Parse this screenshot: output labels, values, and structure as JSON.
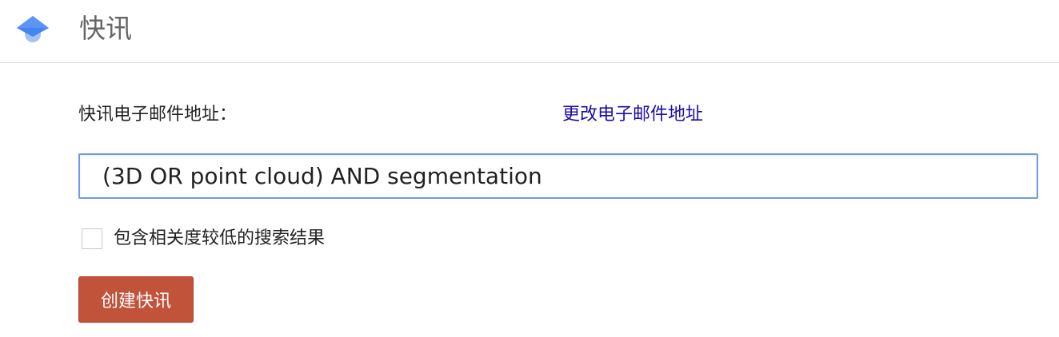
{
  "header": {
    "logo_icon": "scholar-cap-icon",
    "title": "快讯"
  },
  "form": {
    "email_label": "快讯电子邮件地址：",
    "change_email_link": "更改电子邮件地址",
    "query_value": "(3D OR point cloud) AND segmentation",
    "include_less_relevant_label": "包含相关度较低的搜索结果",
    "include_less_relevant_checked": false,
    "create_button_label": "创建快讯"
  },
  "colors": {
    "link": "#1a0dab",
    "button": "#c0533a",
    "input_focus_border": "#6e9ae9",
    "logo_blue": "#4285f4",
    "logo_light_blue": "#a4c2f4"
  }
}
